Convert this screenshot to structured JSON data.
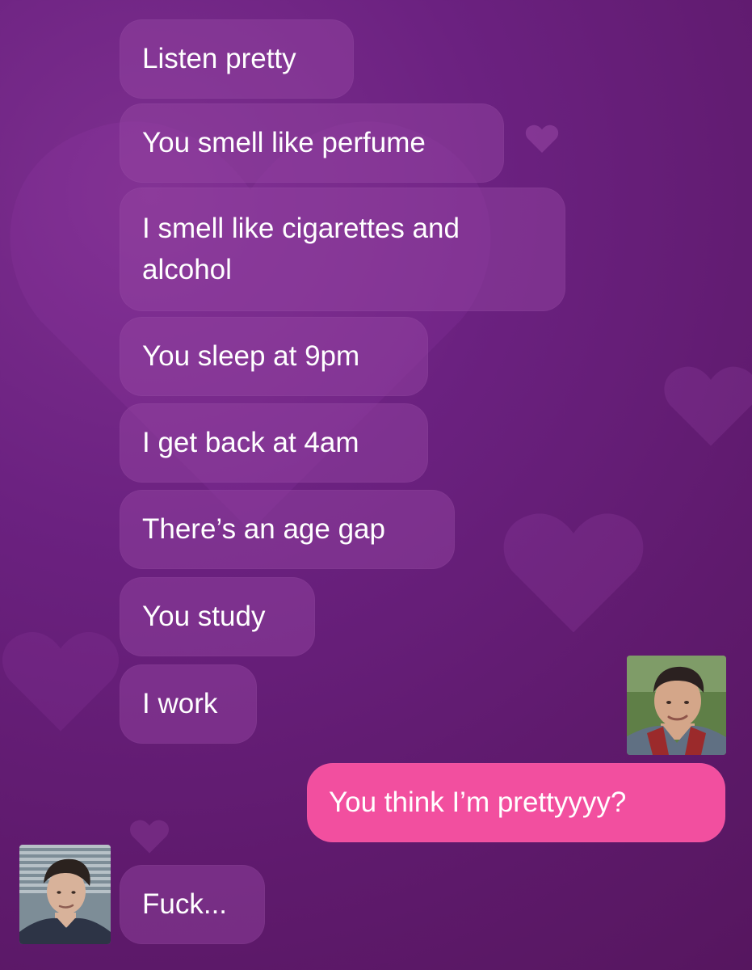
{
  "theme": {
    "background_top": "#7d2f8f",
    "background_bottom": "#56165f",
    "incoming_bubble": "#9a4aa8",
    "outgoing_bubble": "#f24f9f",
    "text": "#ffffff"
  },
  "conversation": {
    "messages": [
      {
        "text": "Listen pretty"
      },
      {
        "text": "You smell like perfume"
      },
      {
        "text": "I smell like cigarettes and alcohol"
      },
      {
        "text": "You sleep at 9pm"
      },
      {
        "text": "I get back at 4am"
      },
      {
        "text": "There’s an age gap"
      },
      {
        "text": "You study"
      },
      {
        "text": "I work"
      },
      {
        "text": "You think I’m prettyyyy?"
      },
      {
        "text": "Fuck..."
      }
    ]
  },
  "icons": {
    "heart": "heart-icon",
    "avatar": "avatar-icon"
  }
}
